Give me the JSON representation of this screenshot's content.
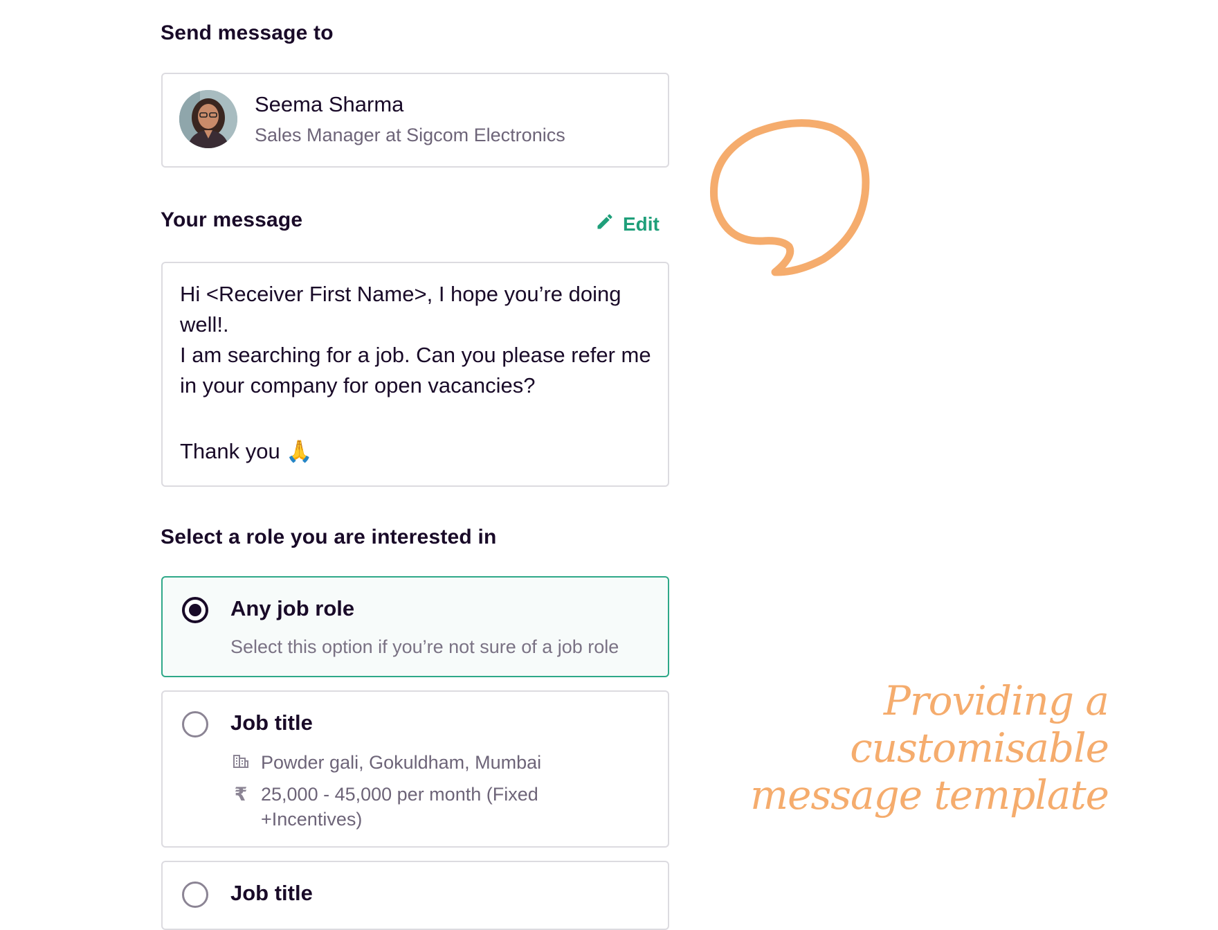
{
  "recipient": {
    "section_title": "Send message to",
    "name": "Seema Sharma",
    "subtitle": "Sales Manager at Sigcom Electronics"
  },
  "message": {
    "section_title": "Your message",
    "edit_label": "Edit",
    "body": "Hi <Receiver First Name>, I hope you’re doing well!.\nI am searching for a job. Can you please refer me in your company for open vacancies?",
    "closing": "Thank you 🙏"
  },
  "roles": {
    "section_title": "Select a role you are interested in",
    "options": [
      {
        "title": "Any job role",
        "subtitle": "Select this option if you’re not sure of a job role",
        "selected": true
      },
      {
        "title": "Job title",
        "location": "Powder gali, Gokuldham, Mumbai",
        "salary": "25,000 - 45,000 per month (Fixed +Incentives)",
        "selected": false
      },
      {
        "title": "Job title",
        "selected": false
      }
    ]
  },
  "annotation": {
    "line1": "Providing a",
    "line2": "customisable",
    "line3": "message template"
  },
  "colors": {
    "accent": "#1f9f7a",
    "annotation": "#f5ac6d",
    "text": "#190a28",
    "muted": "#6d6478"
  }
}
